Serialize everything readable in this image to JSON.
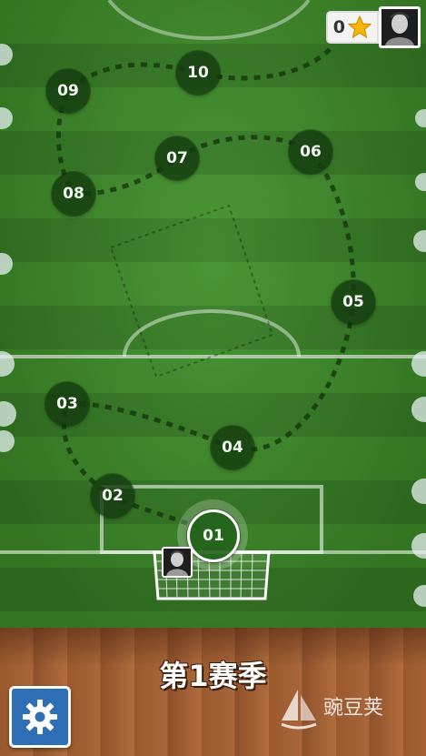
{
  "screen": "season-level-map",
  "season_title": "第1赛季",
  "stars": {
    "count": "0"
  },
  "levels": [
    {
      "id": "01",
      "label": "01",
      "status": "current"
    },
    {
      "id": "02",
      "label": "02",
      "status": "locked"
    },
    {
      "id": "03",
      "label": "03",
      "status": "locked"
    },
    {
      "id": "04",
      "label": "04",
      "status": "locked"
    },
    {
      "id": "05",
      "label": "05",
      "status": "locked"
    },
    {
      "id": "06",
      "label": "06",
      "status": "locked"
    },
    {
      "id": "07",
      "label": "07",
      "status": "locked"
    },
    {
      "id": "08",
      "label": "08",
      "status": "locked"
    },
    {
      "id": "09",
      "label": "09",
      "status": "locked"
    },
    {
      "id": "10",
      "label": "10",
      "status": "locked"
    }
  ],
  "icons": {
    "settings": "gear-icon",
    "star": "star-icon",
    "watermark": "sailboat-logo"
  },
  "watermark_text": "豌豆荚",
  "colors": {
    "pitch": "#3f8f2a",
    "floor": "#a8663a",
    "settings_bg": "#2f6fb5",
    "star": "#f5b60a"
  }
}
